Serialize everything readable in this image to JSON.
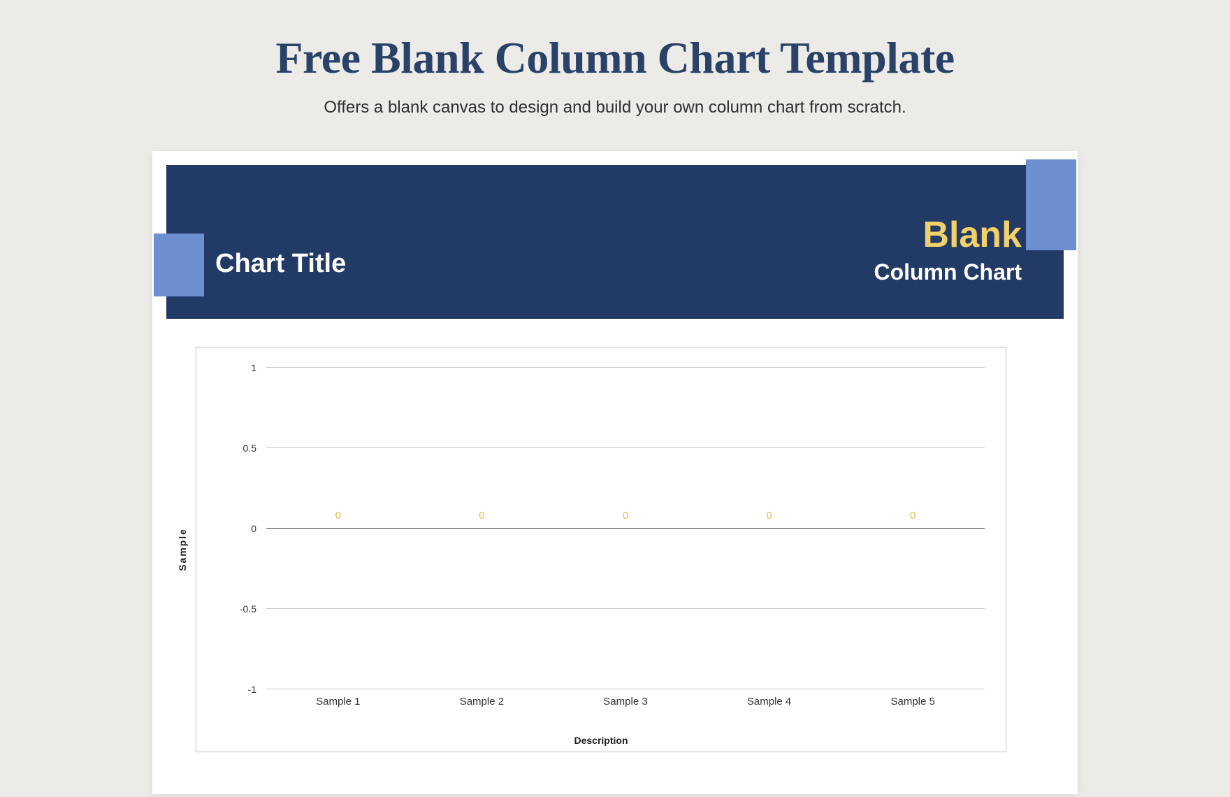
{
  "page": {
    "title": "Free Blank Column Chart Template",
    "subtitle": "Offers a blank canvas to design and build your own column chart from scratch."
  },
  "banner": {
    "chart_title_label": "Chart Title",
    "blank_label": "Blank",
    "column_chart_label": "Column Chart"
  },
  "axes": {
    "ylabel": "Sample",
    "xlabel": "Description",
    "ticks": {
      "t0": "1",
      "t1": "0.5",
      "t2": "0",
      "t3": "-0.5",
      "t4": "-1"
    },
    "cats": {
      "c0": "Sample 1",
      "c1": "Sample 2",
      "c2": "Sample 3",
      "c3": "Sample 4",
      "c4": "Sample 5"
    },
    "vals": {
      "v0": "0",
      "v1": "0",
      "v2": "0",
      "v3": "0",
      "v4": "0"
    }
  },
  "chart_data": {
    "type": "bar",
    "title": "Chart Title",
    "xlabel": "Description",
    "ylabel": "Sample",
    "ylim": [
      -1,
      1
    ],
    "yticks": [
      -1,
      -0.5,
      0,
      0.5,
      1
    ],
    "categories": [
      "Sample 1",
      "Sample 2",
      "Sample 3",
      "Sample 4",
      "Sample 5"
    ],
    "values": [
      0,
      0,
      0,
      0,
      0
    ],
    "data_label_color": "#e8b94c",
    "grid": true
  }
}
